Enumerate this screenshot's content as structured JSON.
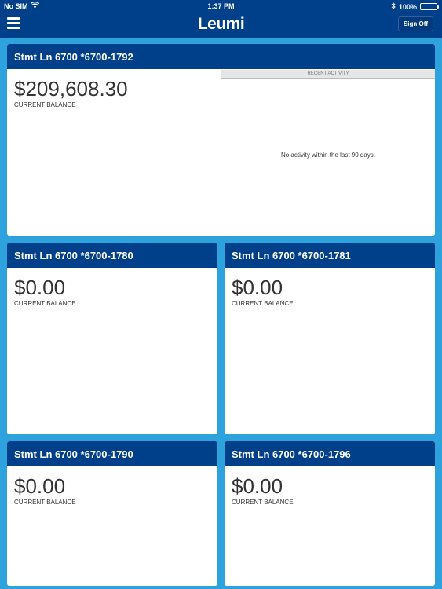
{
  "status_bar": {
    "carrier": "No SIM",
    "time": "1:37 PM",
    "battery": "100%"
  },
  "header": {
    "title": "Leumi",
    "sign_off": "Sign Off"
  },
  "accounts": [
    {
      "name": "Stmt Ln 6700 *6700-1792",
      "balance": "$209,608.30",
      "balance_label": "CURRENT BALANCE",
      "recent_activity_title": "RECENT ACTIVITY",
      "recent_activity_message": "No activity within the last 90 days."
    },
    {
      "name": "Stmt Ln 6700 *6700-1780",
      "balance": "$0.00",
      "balance_label": "CURRENT BALANCE"
    },
    {
      "name": "Stmt Ln 6700 *6700-1781",
      "balance": "$0.00",
      "balance_label": "CURRENT BALANCE"
    },
    {
      "name": "Stmt Ln 6700 *6700-1790",
      "balance": "$0.00",
      "balance_label": "CURRENT BALANCE"
    },
    {
      "name": "Stmt Ln 6700 *6700-1796",
      "balance": "$0.00",
      "balance_label": "CURRENT BALANCE"
    }
  ],
  "colors": {
    "header_bg": "#00408a",
    "page_bg": "#2ea2dc",
    "card_bg": "#ffffff"
  }
}
